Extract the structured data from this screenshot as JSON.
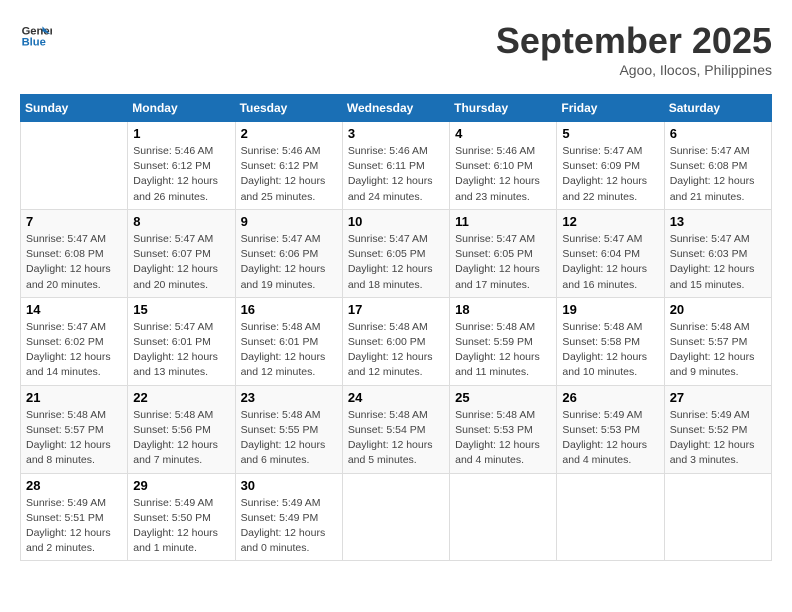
{
  "header": {
    "logo_line1": "General",
    "logo_line2": "Blue",
    "month_title": "September 2025",
    "location": "Agoo, Ilocos, Philippines"
  },
  "days_of_week": [
    "Sunday",
    "Monday",
    "Tuesday",
    "Wednesday",
    "Thursday",
    "Friday",
    "Saturday"
  ],
  "weeks": [
    [
      {
        "day": "",
        "info": ""
      },
      {
        "day": "1",
        "info": "Sunrise: 5:46 AM\nSunset: 6:12 PM\nDaylight: 12 hours\nand 26 minutes."
      },
      {
        "day": "2",
        "info": "Sunrise: 5:46 AM\nSunset: 6:12 PM\nDaylight: 12 hours\nand 25 minutes."
      },
      {
        "day": "3",
        "info": "Sunrise: 5:46 AM\nSunset: 6:11 PM\nDaylight: 12 hours\nand 24 minutes."
      },
      {
        "day": "4",
        "info": "Sunrise: 5:46 AM\nSunset: 6:10 PM\nDaylight: 12 hours\nand 23 minutes."
      },
      {
        "day": "5",
        "info": "Sunrise: 5:47 AM\nSunset: 6:09 PM\nDaylight: 12 hours\nand 22 minutes."
      },
      {
        "day": "6",
        "info": "Sunrise: 5:47 AM\nSunset: 6:08 PM\nDaylight: 12 hours\nand 21 minutes."
      }
    ],
    [
      {
        "day": "7",
        "info": "Sunrise: 5:47 AM\nSunset: 6:08 PM\nDaylight: 12 hours\nand 20 minutes."
      },
      {
        "day": "8",
        "info": "Sunrise: 5:47 AM\nSunset: 6:07 PM\nDaylight: 12 hours\nand 20 minutes."
      },
      {
        "day": "9",
        "info": "Sunrise: 5:47 AM\nSunset: 6:06 PM\nDaylight: 12 hours\nand 19 minutes."
      },
      {
        "day": "10",
        "info": "Sunrise: 5:47 AM\nSunset: 6:05 PM\nDaylight: 12 hours\nand 18 minutes."
      },
      {
        "day": "11",
        "info": "Sunrise: 5:47 AM\nSunset: 6:05 PM\nDaylight: 12 hours\nand 17 minutes."
      },
      {
        "day": "12",
        "info": "Sunrise: 5:47 AM\nSunset: 6:04 PM\nDaylight: 12 hours\nand 16 minutes."
      },
      {
        "day": "13",
        "info": "Sunrise: 5:47 AM\nSunset: 6:03 PM\nDaylight: 12 hours\nand 15 minutes."
      }
    ],
    [
      {
        "day": "14",
        "info": "Sunrise: 5:47 AM\nSunset: 6:02 PM\nDaylight: 12 hours\nand 14 minutes."
      },
      {
        "day": "15",
        "info": "Sunrise: 5:47 AM\nSunset: 6:01 PM\nDaylight: 12 hours\nand 13 minutes."
      },
      {
        "day": "16",
        "info": "Sunrise: 5:48 AM\nSunset: 6:01 PM\nDaylight: 12 hours\nand 12 minutes."
      },
      {
        "day": "17",
        "info": "Sunrise: 5:48 AM\nSunset: 6:00 PM\nDaylight: 12 hours\nand 12 minutes."
      },
      {
        "day": "18",
        "info": "Sunrise: 5:48 AM\nSunset: 5:59 PM\nDaylight: 12 hours\nand 11 minutes."
      },
      {
        "day": "19",
        "info": "Sunrise: 5:48 AM\nSunset: 5:58 PM\nDaylight: 12 hours\nand 10 minutes."
      },
      {
        "day": "20",
        "info": "Sunrise: 5:48 AM\nSunset: 5:57 PM\nDaylight: 12 hours\nand 9 minutes."
      }
    ],
    [
      {
        "day": "21",
        "info": "Sunrise: 5:48 AM\nSunset: 5:57 PM\nDaylight: 12 hours\nand 8 minutes."
      },
      {
        "day": "22",
        "info": "Sunrise: 5:48 AM\nSunset: 5:56 PM\nDaylight: 12 hours\nand 7 minutes."
      },
      {
        "day": "23",
        "info": "Sunrise: 5:48 AM\nSunset: 5:55 PM\nDaylight: 12 hours\nand 6 minutes."
      },
      {
        "day": "24",
        "info": "Sunrise: 5:48 AM\nSunset: 5:54 PM\nDaylight: 12 hours\nand 5 minutes."
      },
      {
        "day": "25",
        "info": "Sunrise: 5:48 AM\nSunset: 5:53 PM\nDaylight: 12 hours\nand 4 minutes."
      },
      {
        "day": "26",
        "info": "Sunrise: 5:49 AM\nSunset: 5:53 PM\nDaylight: 12 hours\nand 4 minutes."
      },
      {
        "day": "27",
        "info": "Sunrise: 5:49 AM\nSunset: 5:52 PM\nDaylight: 12 hours\nand 3 minutes."
      }
    ],
    [
      {
        "day": "28",
        "info": "Sunrise: 5:49 AM\nSunset: 5:51 PM\nDaylight: 12 hours\nand 2 minutes."
      },
      {
        "day": "29",
        "info": "Sunrise: 5:49 AM\nSunset: 5:50 PM\nDaylight: 12 hours\nand 1 minute."
      },
      {
        "day": "30",
        "info": "Sunrise: 5:49 AM\nSunset: 5:49 PM\nDaylight: 12 hours\nand 0 minutes."
      },
      {
        "day": "",
        "info": ""
      },
      {
        "day": "",
        "info": ""
      },
      {
        "day": "",
        "info": ""
      },
      {
        "day": "",
        "info": ""
      }
    ]
  ]
}
